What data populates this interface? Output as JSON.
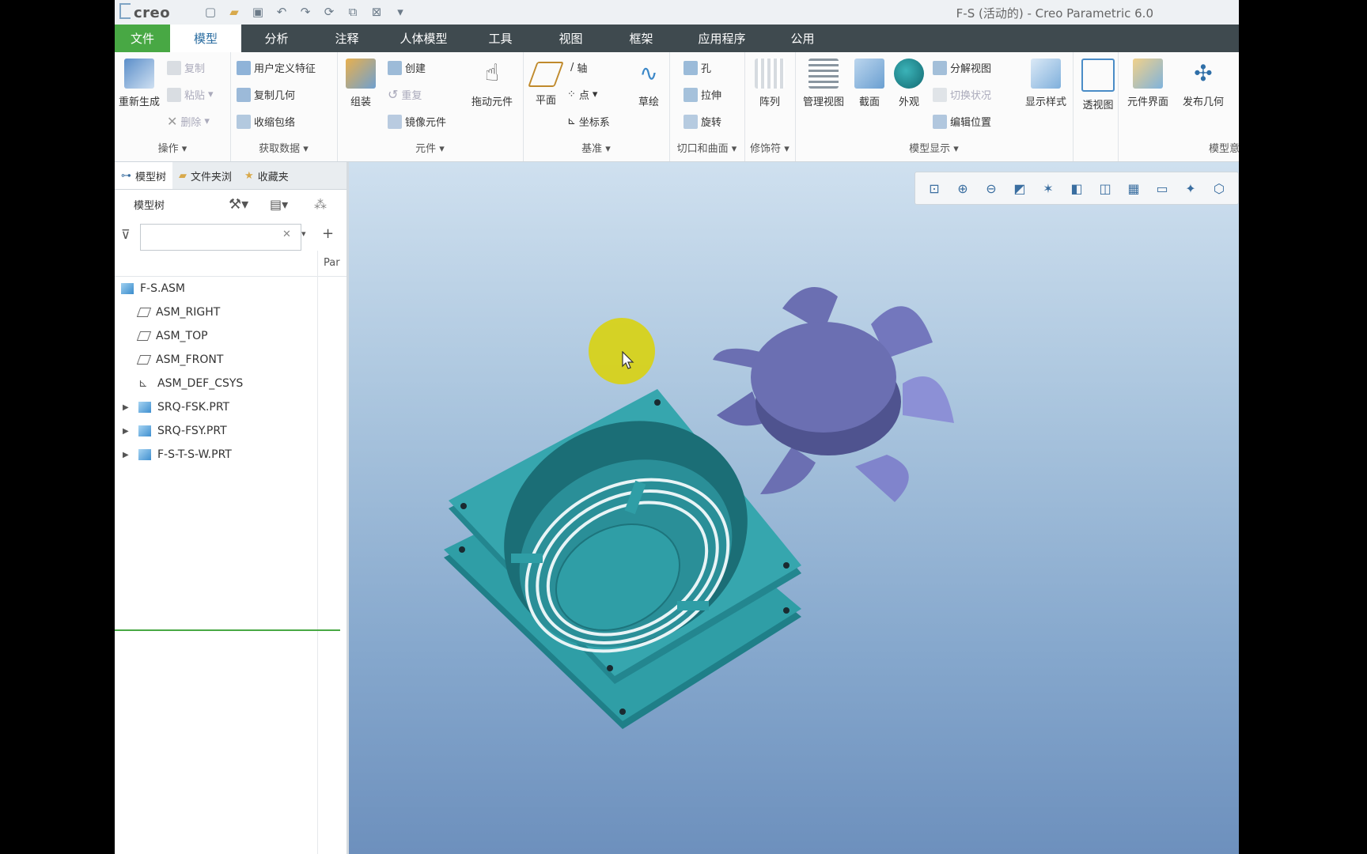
{
  "titlebar": {
    "logo": "creo",
    "window_title": "F-S (活动的) - Creo Parametric 6.0"
  },
  "tabs": [
    {
      "label": "文件"
    },
    {
      "label": "模型"
    },
    {
      "label": "分析"
    },
    {
      "label": "注释"
    },
    {
      "label": "人体模型"
    },
    {
      "label": "工具"
    },
    {
      "label": "视图"
    },
    {
      "label": "框架"
    },
    {
      "label": "应用程序"
    },
    {
      "label": "公用"
    }
  ],
  "ribbon": {
    "operations": {
      "label": "操作",
      "regenerate": "重新生成",
      "copy": "复制",
      "paste": "粘贴",
      "delete": "删除"
    },
    "get_data": {
      "label": "获取数据",
      "udf": "用户定义特征",
      "copy_geom": "复制几何",
      "shrinkwrap": "收缩包络"
    },
    "component": {
      "label": "元件",
      "assemble": "组装",
      "create": "创建",
      "repeat": "重复",
      "mirror": "镜像元件",
      "drag": "拖动元件"
    },
    "datum": {
      "label": "基准",
      "plane": "平面",
      "axis": "轴",
      "point": "点",
      "csys": "坐标系",
      "sketch": "草绘"
    },
    "cut_surface": {
      "label": "切口和曲面",
      "hole": "孔",
      "extrude": "拉伸",
      "revolve": "旋转"
    },
    "modifiers": {
      "label": "修饰符",
      "pattern": "阵列"
    },
    "model_display": {
      "label": "模型显示",
      "manage_views": "管理视图",
      "section": "截面",
      "appearance": "外观",
      "explode": "分解视图",
      "toggle_status": "切换状况",
      "edit_position": "编辑位置",
      "display_style": "显示样式",
      "perspective": "透视图"
    },
    "model_intent": {
      "label": "模型意",
      "comp_interface": "元件界面",
      "publish_geom": "发布几何"
    }
  },
  "panel": {
    "tabs": [
      {
        "label": "模型树"
      },
      {
        "label": "文件夹浏"
      },
      {
        "label": "收藏夹"
      }
    ],
    "tree_label": "模型树",
    "search_placeholder": "",
    "column": "Par"
  },
  "tree": [
    {
      "label": "F-S.ASM",
      "type": "asm"
    },
    {
      "label": "ASM_RIGHT",
      "type": "plane"
    },
    {
      "label": "ASM_TOP",
      "type": "plane"
    },
    {
      "label": "ASM_FRONT",
      "type": "plane"
    },
    {
      "label": "ASM_DEF_CSYS",
      "type": "csys"
    },
    {
      "label": "SRQ-FSK.PRT",
      "type": "part"
    },
    {
      "label": "SRQ-FSY.PRT",
      "type": "part"
    },
    {
      "label": "F-S-T-S-W.PRT",
      "type": "part"
    }
  ],
  "colors": {
    "frame": "#2f9ea6",
    "fan": "#6b6fb2",
    "file_tab": "#48a844",
    "tabbar": "#3f4a4f"
  }
}
